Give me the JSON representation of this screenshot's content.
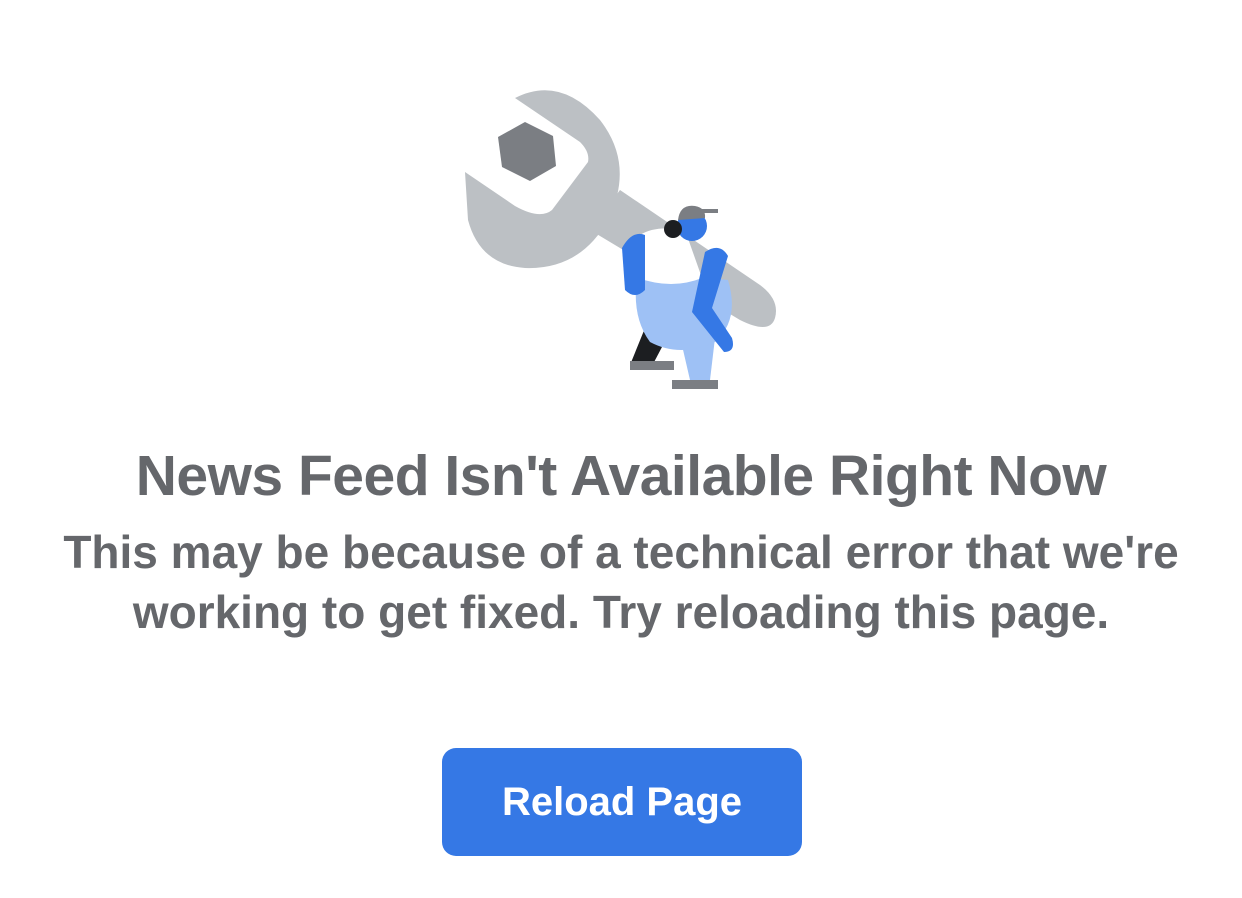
{
  "error": {
    "title": "News Feed Isn't Available Right Now",
    "description": "This may be because of a technical error that we're working to get fixed. Try reloading this page.",
    "illustration_icon": "wrench-worker-illustration"
  },
  "actions": {
    "reload_label": "Reload Page"
  },
  "colors": {
    "text": "#65676b",
    "button": "#3578e5",
    "button_text": "#ffffff",
    "wrench": "#bcc0c4",
    "nut": "#7b7e83",
    "figure_primary": "#3578e5",
    "figure_light": "#9ec1f5"
  }
}
